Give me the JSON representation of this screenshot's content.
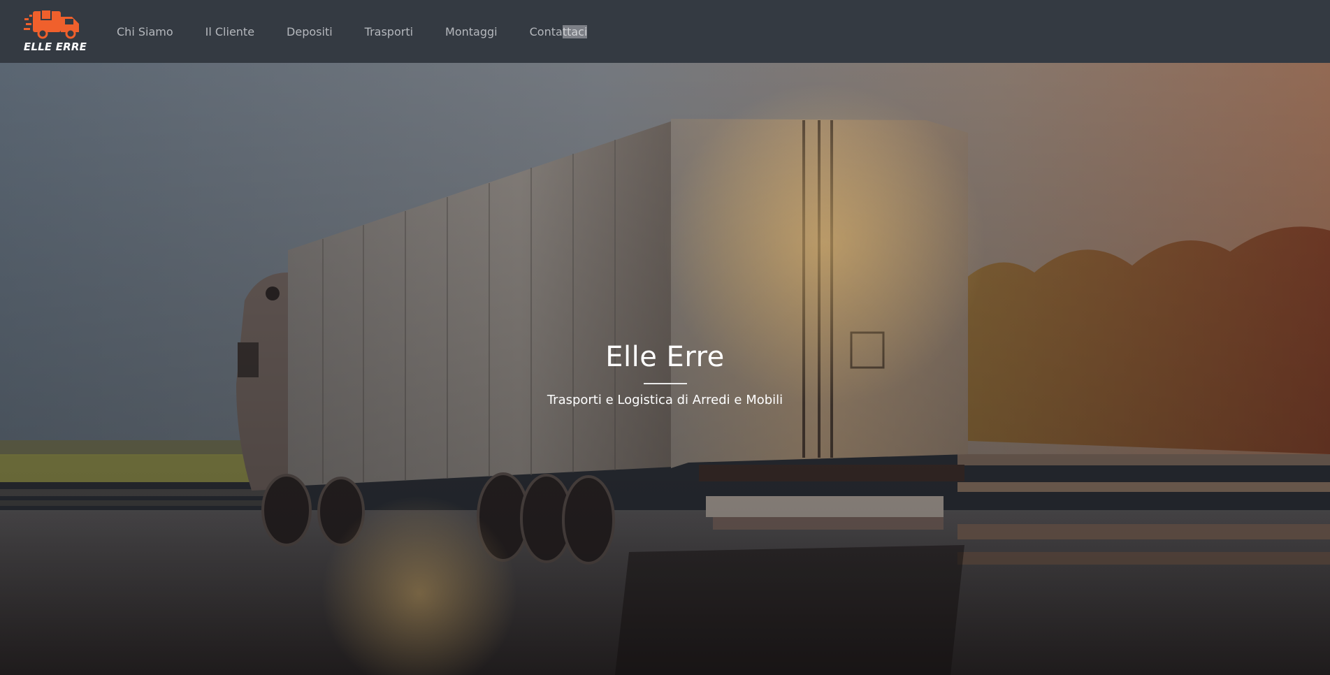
{
  "brand": {
    "logo_text": "ELLE ERRE",
    "accent_color": "#f0602c"
  },
  "nav": {
    "items": [
      {
        "label": "Chi Siamo"
      },
      {
        "label": "Il Cliente"
      },
      {
        "label": "Depositi"
      },
      {
        "label": "Trasporti"
      },
      {
        "label": "Montaggi"
      },
      {
        "label_prefix": "Conta",
        "label_selected": "ttaci"
      }
    ]
  },
  "hero": {
    "title": "Elle Erre",
    "subtitle": "Trasporti e Logistica di Arredi e Mobili",
    "background_icon": "truck-on-road-photo"
  }
}
